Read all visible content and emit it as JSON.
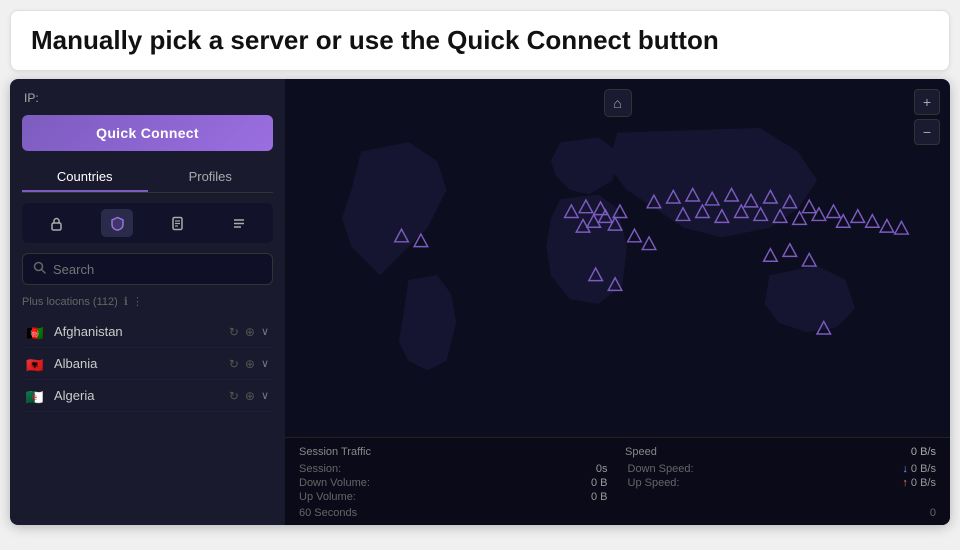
{
  "header": {
    "title": "Manually pick a server or use the Quick Connect button"
  },
  "left_panel": {
    "ip_label": "IP:",
    "quick_connect": "Quick Connect",
    "tabs": [
      {
        "label": "Countries",
        "active": true
      },
      {
        "label": "Profiles",
        "active": false
      }
    ],
    "filter_icons": [
      {
        "name": "lock-icon",
        "symbol": "🔒",
        "active": false
      },
      {
        "name": "shield-icon",
        "symbol": "🛡",
        "active": true
      },
      {
        "name": "document-icon",
        "symbol": "📋",
        "active": false
      },
      {
        "name": "list-icon",
        "symbol": "≡",
        "active": false
      }
    ],
    "search_placeholder": "Search",
    "plus_locations_label": "Plus locations (112)",
    "countries": [
      {
        "name": "Afghanistan",
        "flag": "🇦🇫"
      },
      {
        "name": "Albania",
        "flag": "🇦🇱"
      },
      {
        "name": "Algeria",
        "flag": "🇩🇿"
      }
    ]
  },
  "right_panel": {
    "home_btn": "⌂",
    "zoom_in": "+",
    "zoom_out": "−",
    "stats": {
      "title": "Session Traffic",
      "speed_label": "Speed",
      "speed_value": "0 B/s",
      "rows": [
        {
          "label": "Session:",
          "value": "0s",
          "arrow": ""
        },
        {
          "label": "Down Volume:",
          "value": "0   B",
          "arrow": ""
        },
        {
          "label": "Up Volume:",
          "value": "0   B",
          "arrow": ""
        },
        {
          "label": "Down Speed:",
          "value": "0  B/s",
          "arrow": "down"
        },
        {
          "label": "Up Speed:",
          "value": "0  B/s",
          "arrow": "up"
        }
      ],
      "seconds_label": "60 Seconds",
      "zero_label": "0"
    }
  }
}
